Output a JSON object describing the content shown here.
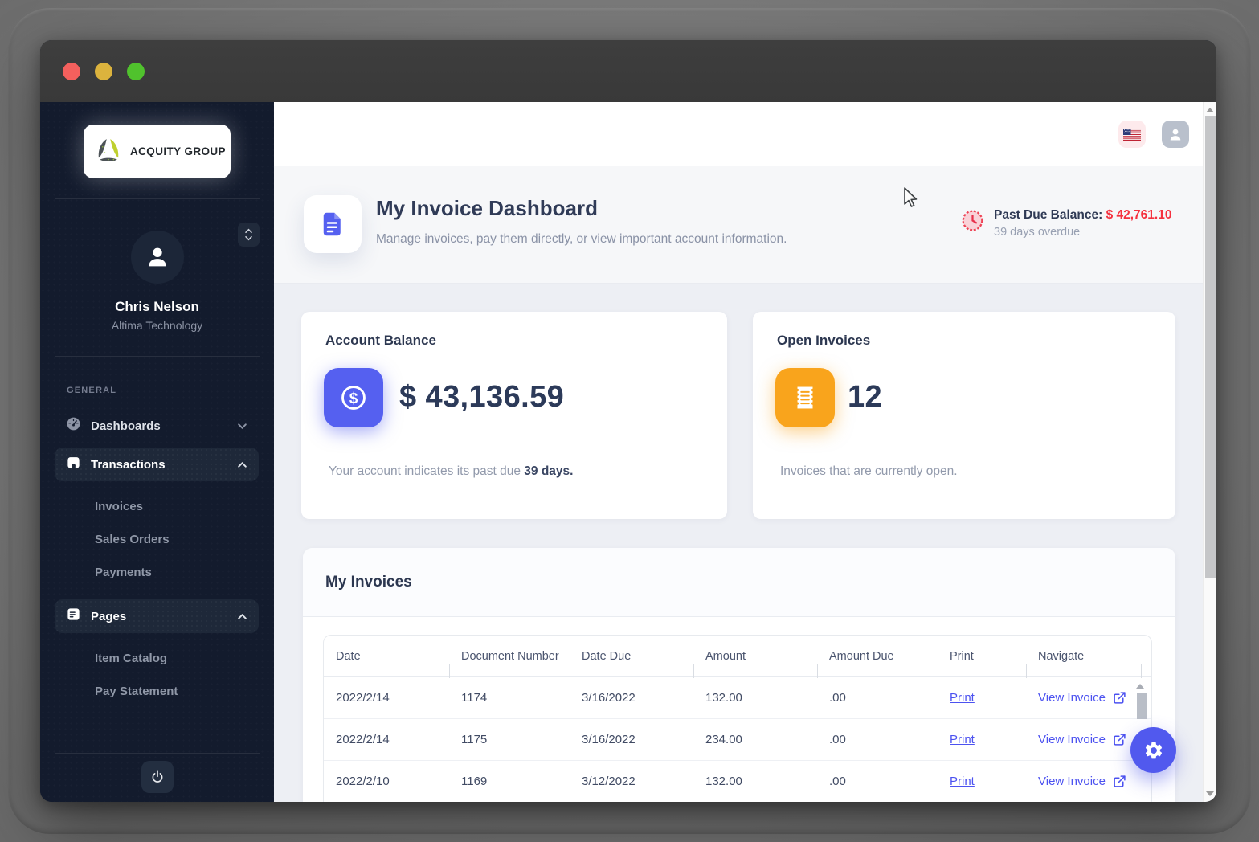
{
  "colors": {
    "accent_indigo": "#5560f0",
    "accent_orange": "#f9a41c",
    "alert_red": "#f5313f",
    "sidebar_bg": "#131b2d",
    "navy_text": "#2f3a55"
  },
  "sidebar": {
    "logo_label": "ACQUITY GROUP",
    "user_name": "Chris Nelson",
    "user_company": "Altima Technology",
    "section_label": "GENERAL",
    "menu": {
      "dashboards": "Dashboards",
      "transactions": "Transactions",
      "transactions_children": [
        "Invoices",
        "Sales Orders",
        "Payments"
      ],
      "pages": "Pages",
      "pages_children": [
        "Item Catalog",
        "Pay Statement"
      ]
    }
  },
  "hero": {
    "title": "My Invoice Dashboard",
    "subtitle": "Manage invoices, pay them directly, or view important account information.",
    "past_due_label": "Past Due Balance: ",
    "past_due_amount": "$ 42,761.10",
    "past_due_note": "39 days overdue"
  },
  "cards": {
    "account_balance": {
      "title": "Account Balance",
      "amount": "$ 43,136.59",
      "note_text": "Your account indicates its past due ",
      "note_bold": "39 days."
    },
    "open_invoices": {
      "title": "Open Invoices",
      "count": "12",
      "note": "Invoices that are currently open."
    }
  },
  "invoices": {
    "title": "My Invoices",
    "columns": {
      "date": "Date",
      "doc": "Document Number",
      "due": "Date Due",
      "amount": "Amount",
      "amount_due": "Amount Due",
      "print": "Print",
      "navigate": "Navigate"
    },
    "print_label": "Print",
    "view_label": "View Invoice",
    "rows": [
      {
        "date": "2022/2/14",
        "doc": "1174",
        "due": "3/16/2022",
        "amount": "132.00",
        "amount_due": ".00"
      },
      {
        "date": "2022/2/14",
        "doc": "1175",
        "due": "3/16/2022",
        "amount": "234.00",
        "amount_due": ".00"
      },
      {
        "date": "2022/2/10",
        "doc": "1169",
        "due": "3/12/2022",
        "amount": "132.00",
        "amount_due": ".00"
      }
    ]
  }
}
